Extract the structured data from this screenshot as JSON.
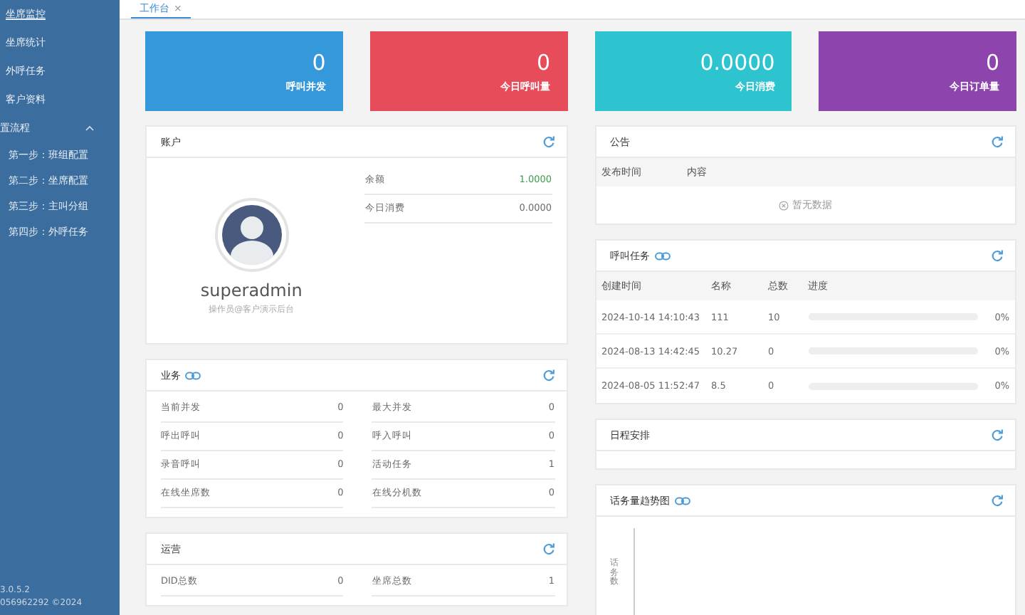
{
  "sidebar": {
    "items": [
      {
        "label": "坐席监控",
        "selected": true
      },
      {
        "label": "坐席统计",
        "selected": false
      },
      {
        "label": "外呼任务",
        "selected": false
      },
      {
        "label": "客户资料",
        "selected": false
      },
      {
        "label": "置流程",
        "selected": false,
        "expanded": true,
        "children": [
          {
            "label": "第一步：班组配置",
            "selected": false
          },
          {
            "label": "第二步：坐席配置",
            "selected": false
          },
          {
            "label": "第三步：主叫分组",
            "selected": false
          },
          {
            "label": "第四步：外呼任务",
            "selected": false
          }
        ]
      }
    ],
    "version": "3.0.5.2",
    "footer": "056962292 ©2024"
  },
  "tabs": [
    {
      "label": "工作台",
      "selected": true,
      "close": "×"
    }
  ],
  "stats": [
    {
      "value": "0",
      "label": "呼叫并发",
      "color": "#3498db"
    },
    {
      "value": "0",
      "label": "今日呼叫量",
      "color": "#e74c5a"
    },
    {
      "value": "0.0000",
      "label": "今日消费",
      "color": "#2ec4cf"
    },
    {
      "value": "0",
      "label": "今日订单量",
      "color": "#8e44ad"
    }
  ],
  "account": {
    "title": "账户",
    "username": "superadmin",
    "subtitle": "操作员@客户演示后台",
    "rows": [
      {
        "label": "余额",
        "value": "1.0000",
        "kind": "positive"
      },
      {
        "label": "今日消费",
        "value": "0.0000",
        "kind": "plain"
      }
    ]
  },
  "business": {
    "title": "业务",
    "rows": [
      {
        "label": "当前并发",
        "value": "0"
      },
      {
        "label": "最大并发",
        "value": "0"
      },
      {
        "label": "呼出呼叫",
        "value": "0"
      },
      {
        "label": "呼入呼叫",
        "value": "0"
      },
      {
        "label": "录音呼叫",
        "value": "0"
      },
      {
        "label": "活动任务",
        "value": "1"
      },
      {
        "label": "在线坐席数",
        "value": "0"
      },
      {
        "label": "在线分机数",
        "value": "0"
      }
    ]
  },
  "operations": {
    "title": "运营",
    "rows": [
      {
        "label": "DID总数",
        "value": "0"
      },
      {
        "label": "坐席总数",
        "value": "1"
      }
    ]
  },
  "announcements": {
    "title": "公告",
    "columns": [
      "发布时间",
      "内容"
    ],
    "empty": "暂无数据"
  },
  "tasks": {
    "title": "呼叫任务",
    "columns": [
      "创建时间",
      "名称",
      "总数",
      "进度"
    ],
    "rows": [
      {
        "created": "2024-10-14 14:10:43",
        "name": "111",
        "total": "10",
        "level": 0,
        "percent": "0%"
      },
      {
        "created": "2024-08-13 14:42:45",
        "name": "10.27",
        "total": "0",
        "level": 0,
        "percent": "0%"
      },
      {
        "created": "2024-08-05 11:52:47",
        "name": "8.5",
        "total": "0",
        "level": 0,
        "percent": "0%"
      }
    ]
  },
  "schedule": {
    "title": "日程安排"
  },
  "trend": {
    "title": "话务量趋势图",
    "ylabel": "话务数"
  }
}
